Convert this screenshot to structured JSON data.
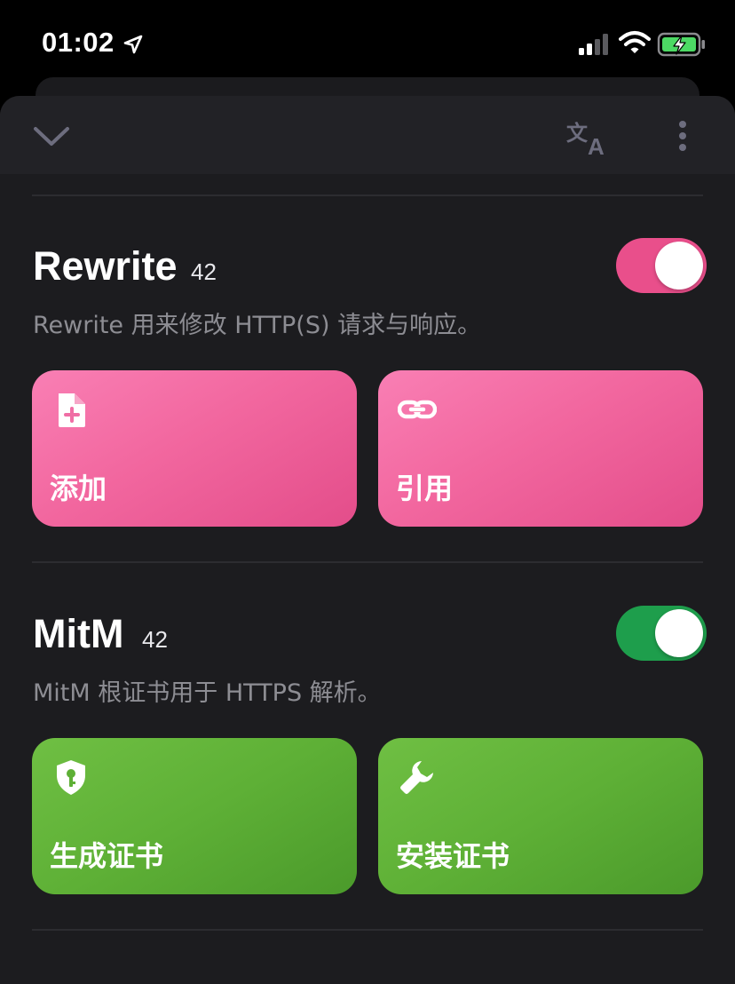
{
  "status_bar": {
    "time": "01:02",
    "icons": [
      "location-arrow-icon",
      "cellular-signal-icon",
      "wifi-icon",
      "battery-charging-icon"
    ]
  },
  "toolbar": {
    "icons": [
      "chevron-down-icon",
      "translate-icon",
      "more-vertical-icon"
    ]
  },
  "sections": [
    {
      "title": "Rewrite",
      "count": "42",
      "description": "Rewrite 用来修改 HTTP(S) 请求与响应。",
      "enabled": true,
      "toggle_color": "#e94f8b",
      "buttons": [
        {
          "label": "添加",
          "icon": "add-file-icon"
        },
        {
          "label": "引用",
          "icon": "link-icon"
        }
      ]
    },
    {
      "title": "MitM",
      "count": "42",
      "description": "MitM 根证书用于 HTTPS 解析。",
      "enabled": true,
      "toggle_color": "#1e9e4c",
      "buttons": [
        {
          "label": "生成证书",
          "icon": "shield-key-icon"
        },
        {
          "label": "安装证书",
          "icon": "wrench-icon"
        }
      ]
    }
  ],
  "colors": {
    "background": "#000000",
    "sheet": "#1c1c1f",
    "rewrite_accent": "#f2679f",
    "mitm_accent": "#5eb036",
    "battery_green": "#4cd964"
  }
}
